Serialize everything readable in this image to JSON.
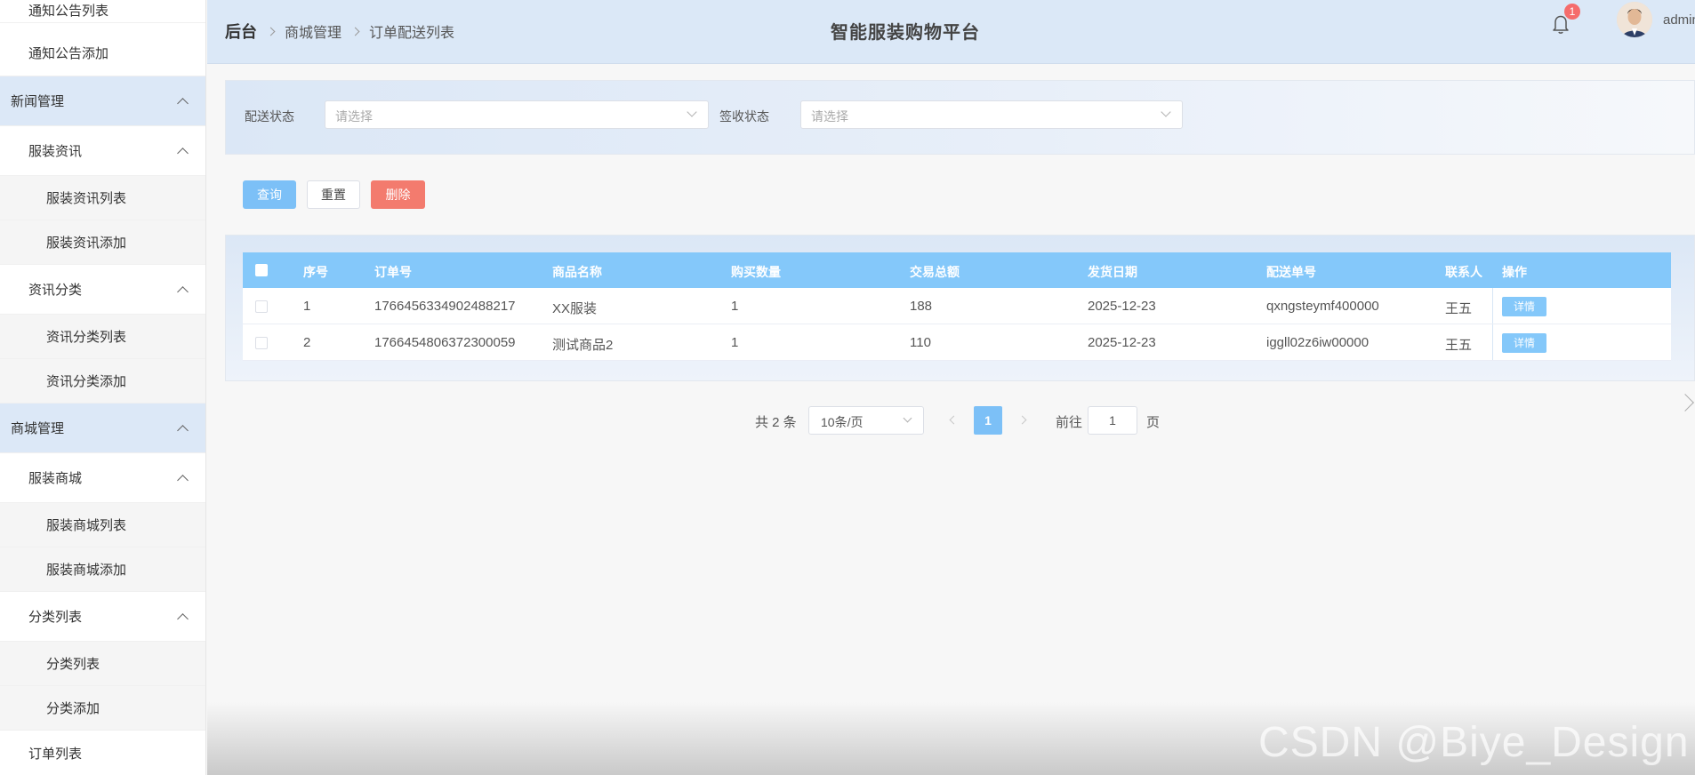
{
  "sidebar": {
    "items": [
      {
        "label": "通知公告列表",
        "level": 2
      },
      {
        "label": "通知公告添加",
        "level": 2
      },
      {
        "label": "新闻管理",
        "level": 1
      },
      {
        "label": "服装资讯",
        "level": 2
      },
      {
        "label": "服装资讯列表",
        "level": 3
      },
      {
        "label": "服装资讯添加",
        "level": 3
      },
      {
        "label": "资讯分类",
        "level": 2
      },
      {
        "label": "资讯分类列表",
        "level": 3
      },
      {
        "label": "资讯分类添加",
        "level": 3
      },
      {
        "label": "商城管理",
        "level": 1
      },
      {
        "label": "服装商城",
        "level": 2
      },
      {
        "label": "服装商城列表",
        "level": 3
      },
      {
        "label": "服装商城添加",
        "level": 3
      },
      {
        "label": "分类列表",
        "level": 2
      },
      {
        "label": "分类列表",
        "level": 3
      },
      {
        "label": "分类添加",
        "level": 3
      },
      {
        "label": "订单列表",
        "level": 2
      }
    ]
  },
  "header": {
    "breadcrumb": [
      "后台",
      "商城管理",
      "订单配送列表"
    ],
    "title": "智能服装购物平台",
    "notification_count": "1",
    "username": "admin"
  },
  "filter": {
    "delivery_status_label": "配送状态",
    "delivery_status_placeholder": "请选择",
    "sign_status_label": "签收状态",
    "sign_status_placeholder": "请选择"
  },
  "actions": {
    "query": "查询",
    "reset": "重置",
    "delete": "删除"
  },
  "table": {
    "headers": [
      "序号",
      "订单号",
      "商品名称",
      "购买数量",
      "交易总额",
      "发货日期",
      "配送单号",
      "联系人",
      "操作"
    ],
    "rows": [
      [
        "1",
        "1766456334902488217",
        "XX服装",
        "1",
        "188",
        "2025-12-23",
        "qxngsteymf400000",
        "王五"
      ],
      [
        "2",
        "1766454806372300059",
        "测试商品2",
        "1",
        "110",
        "2025-12-23",
        "iggll02z6iw00000",
        "王五"
      ]
    ],
    "detail_label": "详情"
  },
  "pagination": {
    "total_text": "共 2 条",
    "page_size": "10条/页",
    "current_page": "1",
    "goto_label": "前往",
    "goto_value": "1",
    "page_label": "页"
  },
  "watermark": "CSDN @Biye_Design",
  "colors": {
    "accent": "#7cc0f7",
    "table_header": "#84c8fa",
    "danger": "#f37b6e",
    "badge": "#f56c6c",
    "sidebar_group": "#dce8f7"
  }
}
